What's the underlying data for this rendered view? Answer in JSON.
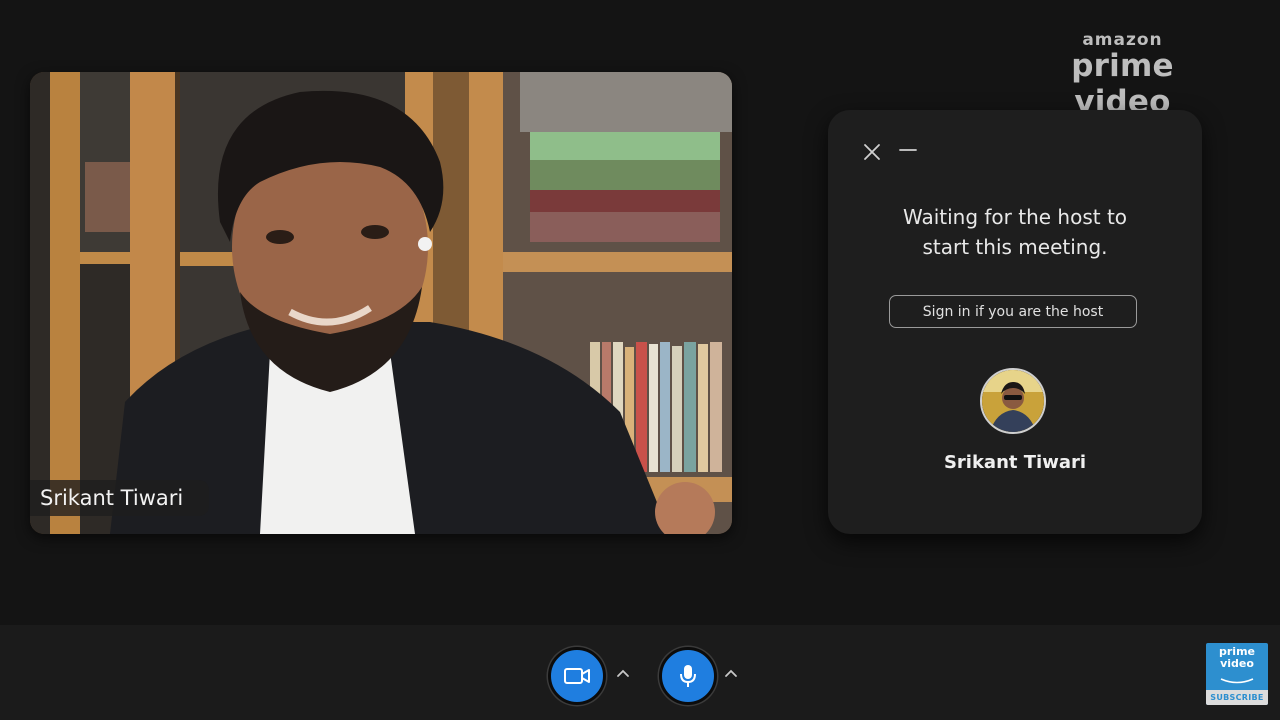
{
  "brand": {
    "small": "amazon",
    "big": "prime video"
  },
  "video": {
    "participant_name": "Srikant Tiwari"
  },
  "panel": {
    "message_line1": "Waiting for the host to",
    "message_line2": "start this meeting.",
    "signin_label": "Sign in if you are the host",
    "host_name": "Srikant Tiwari"
  },
  "toolbar": {
    "camera_icon": "video-camera-icon",
    "mic_icon": "microphone-icon"
  },
  "badge": {
    "line1": "prime",
    "line2": "video",
    "line3": "SUBSCRIBE"
  },
  "colors": {
    "accent": "#1f7ee0",
    "background": "#141414",
    "panel": "#1e1e1e",
    "badge": "#2d8fcf"
  }
}
